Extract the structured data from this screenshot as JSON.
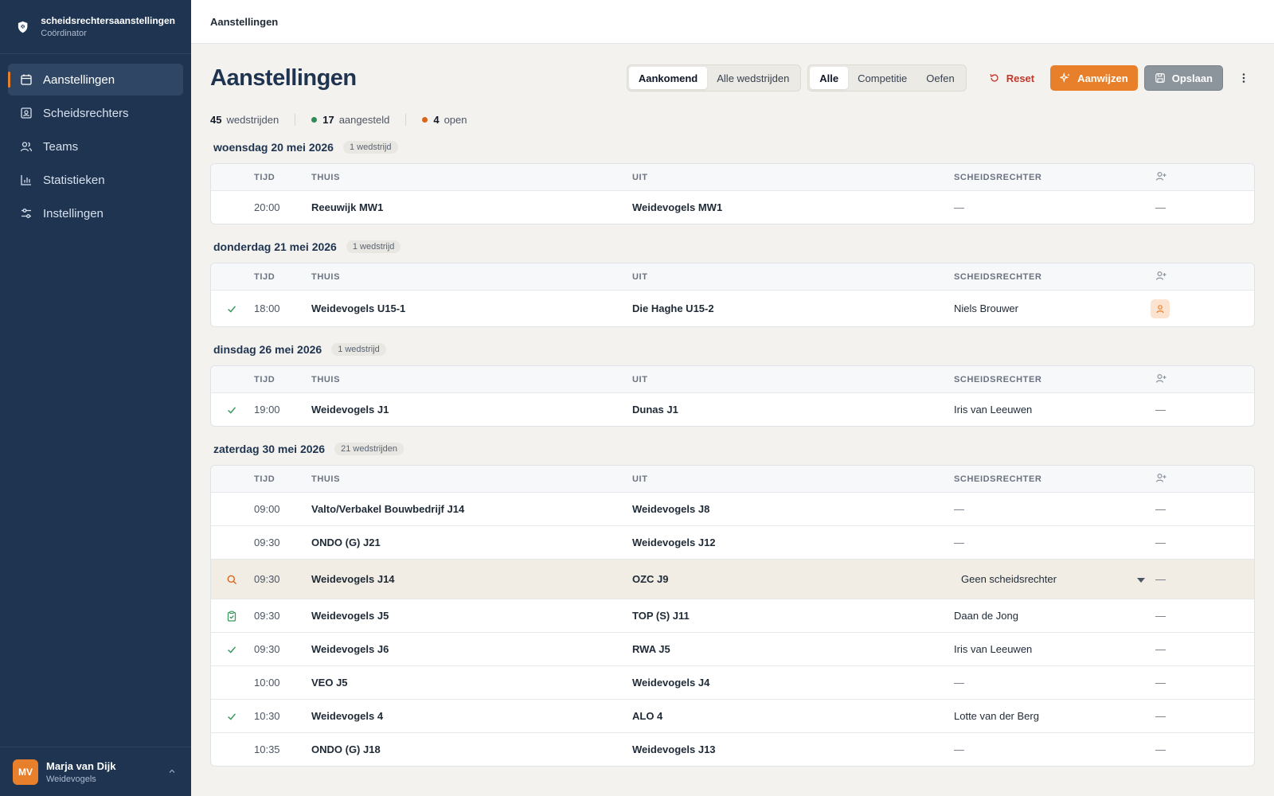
{
  "brand": {
    "title": "scheidsrechtersaanstellingen",
    "subtitle": "Coördinator"
  },
  "nav": [
    {
      "label": "Aanstellingen",
      "icon": "calendar-icon",
      "active": true
    },
    {
      "label": "Scheidsrechters",
      "icon": "id-card-icon",
      "active": false
    },
    {
      "label": "Teams",
      "icon": "users-icon",
      "active": false
    },
    {
      "label": "Statistieken",
      "icon": "bar-chart-icon",
      "active": false
    },
    {
      "label": "Instellingen",
      "icon": "sliders-icon",
      "active": false
    }
  ],
  "user": {
    "initials": "MV",
    "name": "Marja van Dijk",
    "org": "Weidevogels"
  },
  "topbar": {
    "title": "Aanstellingen"
  },
  "page": {
    "title": "Aanstellingen"
  },
  "filters": {
    "period": [
      {
        "label": "Aankomend",
        "active": true
      },
      {
        "label": "Alle wedstrijden",
        "active": false
      }
    ],
    "type": [
      {
        "label": "Alle",
        "active": true
      },
      {
        "label": "Competitie",
        "active": false
      },
      {
        "label": "Oefen",
        "active": false
      }
    ]
  },
  "actions": {
    "reset": "Reset",
    "assign": "Aanwijzen",
    "save": "Opslaan"
  },
  "stats": {
    "total": "45",
    "total_label": "wedstrijden",
    "assigned": "17",
    "assigned_label": "aangesteld",
    "open": "4",
    "open_label": "open"
  },
  "colors": {
    "accent": "#e87f2a",
    "sidebar": "#1e3450",
    "assigned_dot": "#2e8b57",
    "open_dot": "#d9651b",
    "check": "#3a9a5e"
  },
  "table_headers": {
    "time": "TIJD",
    "home": "THUIS",
    "away": "UIT",
    "referee": "SCHEIDSRECHTER"
  },
  "groups": [
    {
      "date": "woensdag 20 mei 2026",
      "count": "1 wedstrijd",
      "matches": [
        {
          "status": "",
          "time": "20:00",
          "home": "Reeuwijk MW1",
          "away": "Weidevogels MW1",
          "referee": "—",
          "action": "—"
        }
      ]
    },
    {
      "date": "donderdag 21 mei 2026",
      "count": "1 wedstrijd",
      "matches": [
        {
          "status": "check",
          "time": "18:00",
          "home": "Weidevogels U15-1",
          "away": "Die Haghe U15-2",
          "referee": "Niels Brouwer",
          "action": "badge"
        }
      ]
    },
    {
      "date": "dinsdag 26 mei 2026",
      "count": "1 wedstrijd",
      "matches": [
        {
          "status": "check",
          "time": "19:00",
          "home": "Weidevogels J1",
          "away": "Dunas J1",
          "referee": "Iris van Leeuwen",
          "action": "—"
        }
      ]
    },
    {
      "date": "zaterdag 30 mei 2026",
      "count": "21 wedstrijden",
      "matches": [
        {
          "status": "",
          "time": "09:00",
          "home": "Valto/Verbakel Bouwbedrijf J14",
          "away": "Weidevogels J8",
          "referee": "—",
          "action": "—"
        },
        {
          "status": "",
          "time": "09:30",
          "home": "ONDO (G) J21",
          "away": "Weidevogels J12",
          "referee": "—",
          "action": "—"
        },
        {
          "status": "search",
          "time": "09:30",
          "home": "Weidevogels J14",
          "away": "OZC J9",
          "referee": "Geen scheidsrechter",
          "action": "—",
          "selected": true
        },
        {
          "status": "clipboard",
          "time": "09:30",
          "home": "Weidevogels J5",
          "away": "TOP (S) J11",
          "referee": "Daan de Jong",
          "action": "—"
        },
        {
          "status": "check",
          "time": "09:30",
          "home": "Weidevogels J6",
          "away": "RWA J5",
          "referee": "Iris van Leeuwen",
          "action": "—"
        },
        {
          "status": "",
          "time": "10:00",
          "home": "VEO J5",
          "away": "Weidevogels J4",
          "referee": "—",
          "action": "—"
        },
        {
          "status": "check",
          "time": "10:30",
          "home": "Weidevogels 4",
          "away": "ALO 4",
          "referee": "Lotte van der Berg",
          "action": "—"
        },
        {
          "status": "",
          "time": "10:35",
          "home": "ONDO (G) J18",
          "away": "Weidevogels J13",
          "referee": "—",
          "action": "—"
        }
      ]
    }
  ]
}
